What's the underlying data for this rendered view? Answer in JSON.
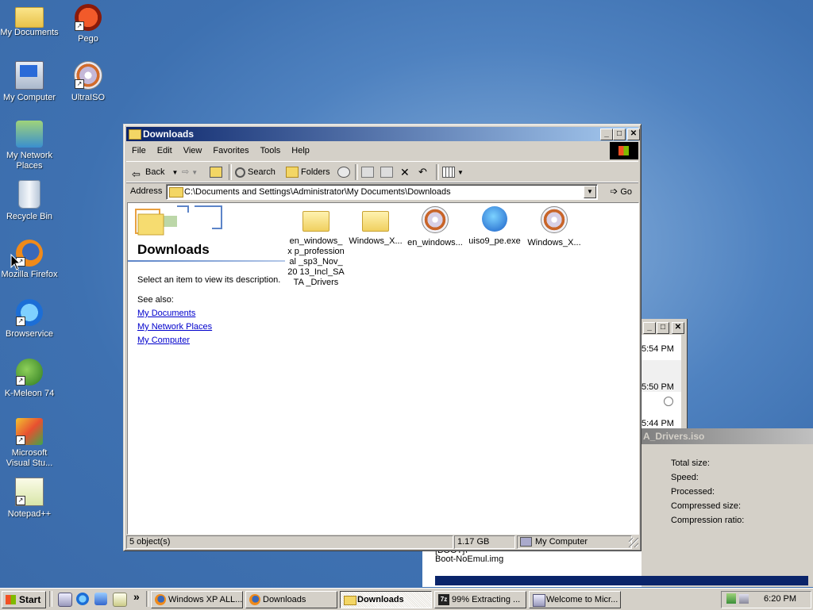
{
  "desktop": {
    "icons_left": [
      {
        "label": "My Documents"
      },
      {
        "label": "My Computer"
      },
      {
        "label": "My Network Places"
      },
      {
        "label": "Recycle Bin"
      },
      {
        "label": "Mozilla Firefox"
      },
      {
        "label": "Browservice"
      },
      {
        "label": "K-Meleon 74"
      },
      {
        "label": "Microsoft Visual Stu..."
      },
      {
        "label": "Notepad++"
      }
    ],
    "icons_right": [
      {
        "label": "Pego"
      },
      {
        "label": "UltraISO"
      }
    ]
  },
  "bg_window_1": {
    "times": [
      "5:54 PM",
      "5:50 PM",
      "5:44 PM"
    ]
  },
  "bg_window_2": {
    "title_fragment": "A_Drivers.iso",
    "stats": [
      "Total size:",
      "Speed:",
      "Processed:",
      "Compressed size:",
      "Compression ratio:"
    ],
    "log_line_1": "[BOOT]\\",
    "log_line_2": "Boot-NoEmul.img"
  },
  "window": {
    "title": "Downloads",
    "menu": [
      "File",
      "Edit",
      "View",
      "Favorites",
      "Tools",
      "Help"
    ],
    "toolbar": {
      "back": "Back",
      "search": "Search",
      "folders": "Folders"
    },
    "address": {
      "label": "Address",
      "path": "C:\\Documents and Settings\\Administrator\\My Documents\\Downloads",
      "go": "Go"
    },
    "pane": {
      "title": "Downloads",
      "description": "Select an item to view its description.",
      "see_also": "See also:",
      "links": [
        "My Documents",
        "My Network Places",
        "My Computer"
      ]
    },
    "files": [
      {
        "name": "en_windows_xp_professional_sp3_Nov_2013_Incl_SATA_Drivers",
        "display": "en_windows_x p_professional _sp3_Nov_20 13_Incl_SATA _Drivers",
        "icon": "folder-icon"
      },
      {
        "name": "Windows_X...",
        "display": "Windows_X...",
        "icon": "folder-icon"
      },
      {
        "name": "en_windows...",
        "display": "en_windows...",
        "icon": "iso-icon"
      },
      {
        "name": "uiso9_pe.exe",
        "display": "uiso9_pe.exe",
        "icon": "exe-icon"
      },
      {
        "name": "Windows_X...",
        "display": "Windows_X...",
        "icon": "iso-icon"
      }
    ],
    "status": {
      "count": "5 object(s)",
      "size": "1.17 GB",
      "location": "My Computer"
    }
  },
  "taskbar": {
    "start": "Start",
    "tasks": [
      {
        "label": "Windows XP ALL...",
        "active": false
      },
      {
        "label": "Downloads",
        "active": false
      },
      {
        "label": "Downloads",
        "active": true
      },
      {
        "label": "99% Extracting ...",
        "active": false
      },
      {
        "label": "Welcome to Micr...",
        "active": false
      }
    ],
    "overflow": "»",
    "clock": "6:20 PM"
  }
}
